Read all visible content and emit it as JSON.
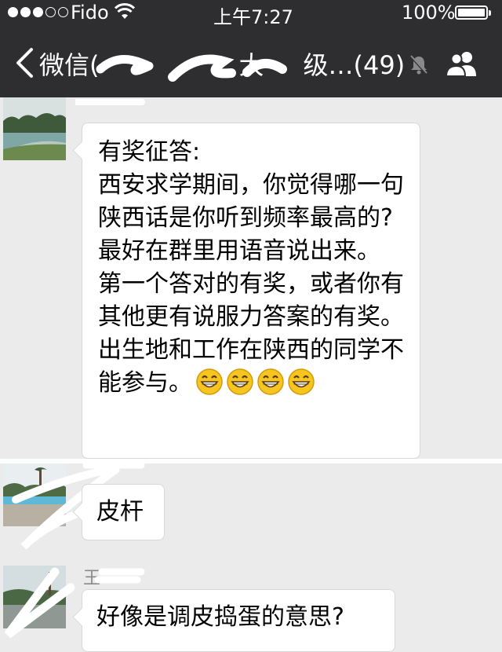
{
  "status_bar": {
    "carrier": "Fido",
    "time": "上午7:27",
    "battery": "100%"
  },
  "nav": {
    "back_label": "微信(",
    "title_visible": "大",
    "title_tail": "级…(49)",
    "back_icon": "chevron-left-icon",
    "mute_icon": "bell-slash-icon",
    "members_icon": "people-icon"
  },
  "messages": [
    {
      "sender": "",
      "text_lines": [
        "有奖征答:",
        "西安求学期间，你觉得哪一句陕西话是你听到频率最高的?最好在群里用语音说出来。",
        "第一个答对的有奖，或者你有其他更有说服力答案的有奖。",
        "出生地和工作在陕西的同学不能参与。"
      ],
      "emoji": [
        "grinning-face",
        "grinning-face",
        "grinning-face",
        "grinning-face"
      ]
    },
    {
      "sender": "",
      "text": "皮杆"
    },
    {
      "sender": "王",
      "text": "好像是调皮捣蛋的意思?"
    }
  ],
  "colors": {
    "topbar": "#2e2e31",
    "chat_bg": "#ebebeb",
    "bubble": "#ffffff"
  }
}
